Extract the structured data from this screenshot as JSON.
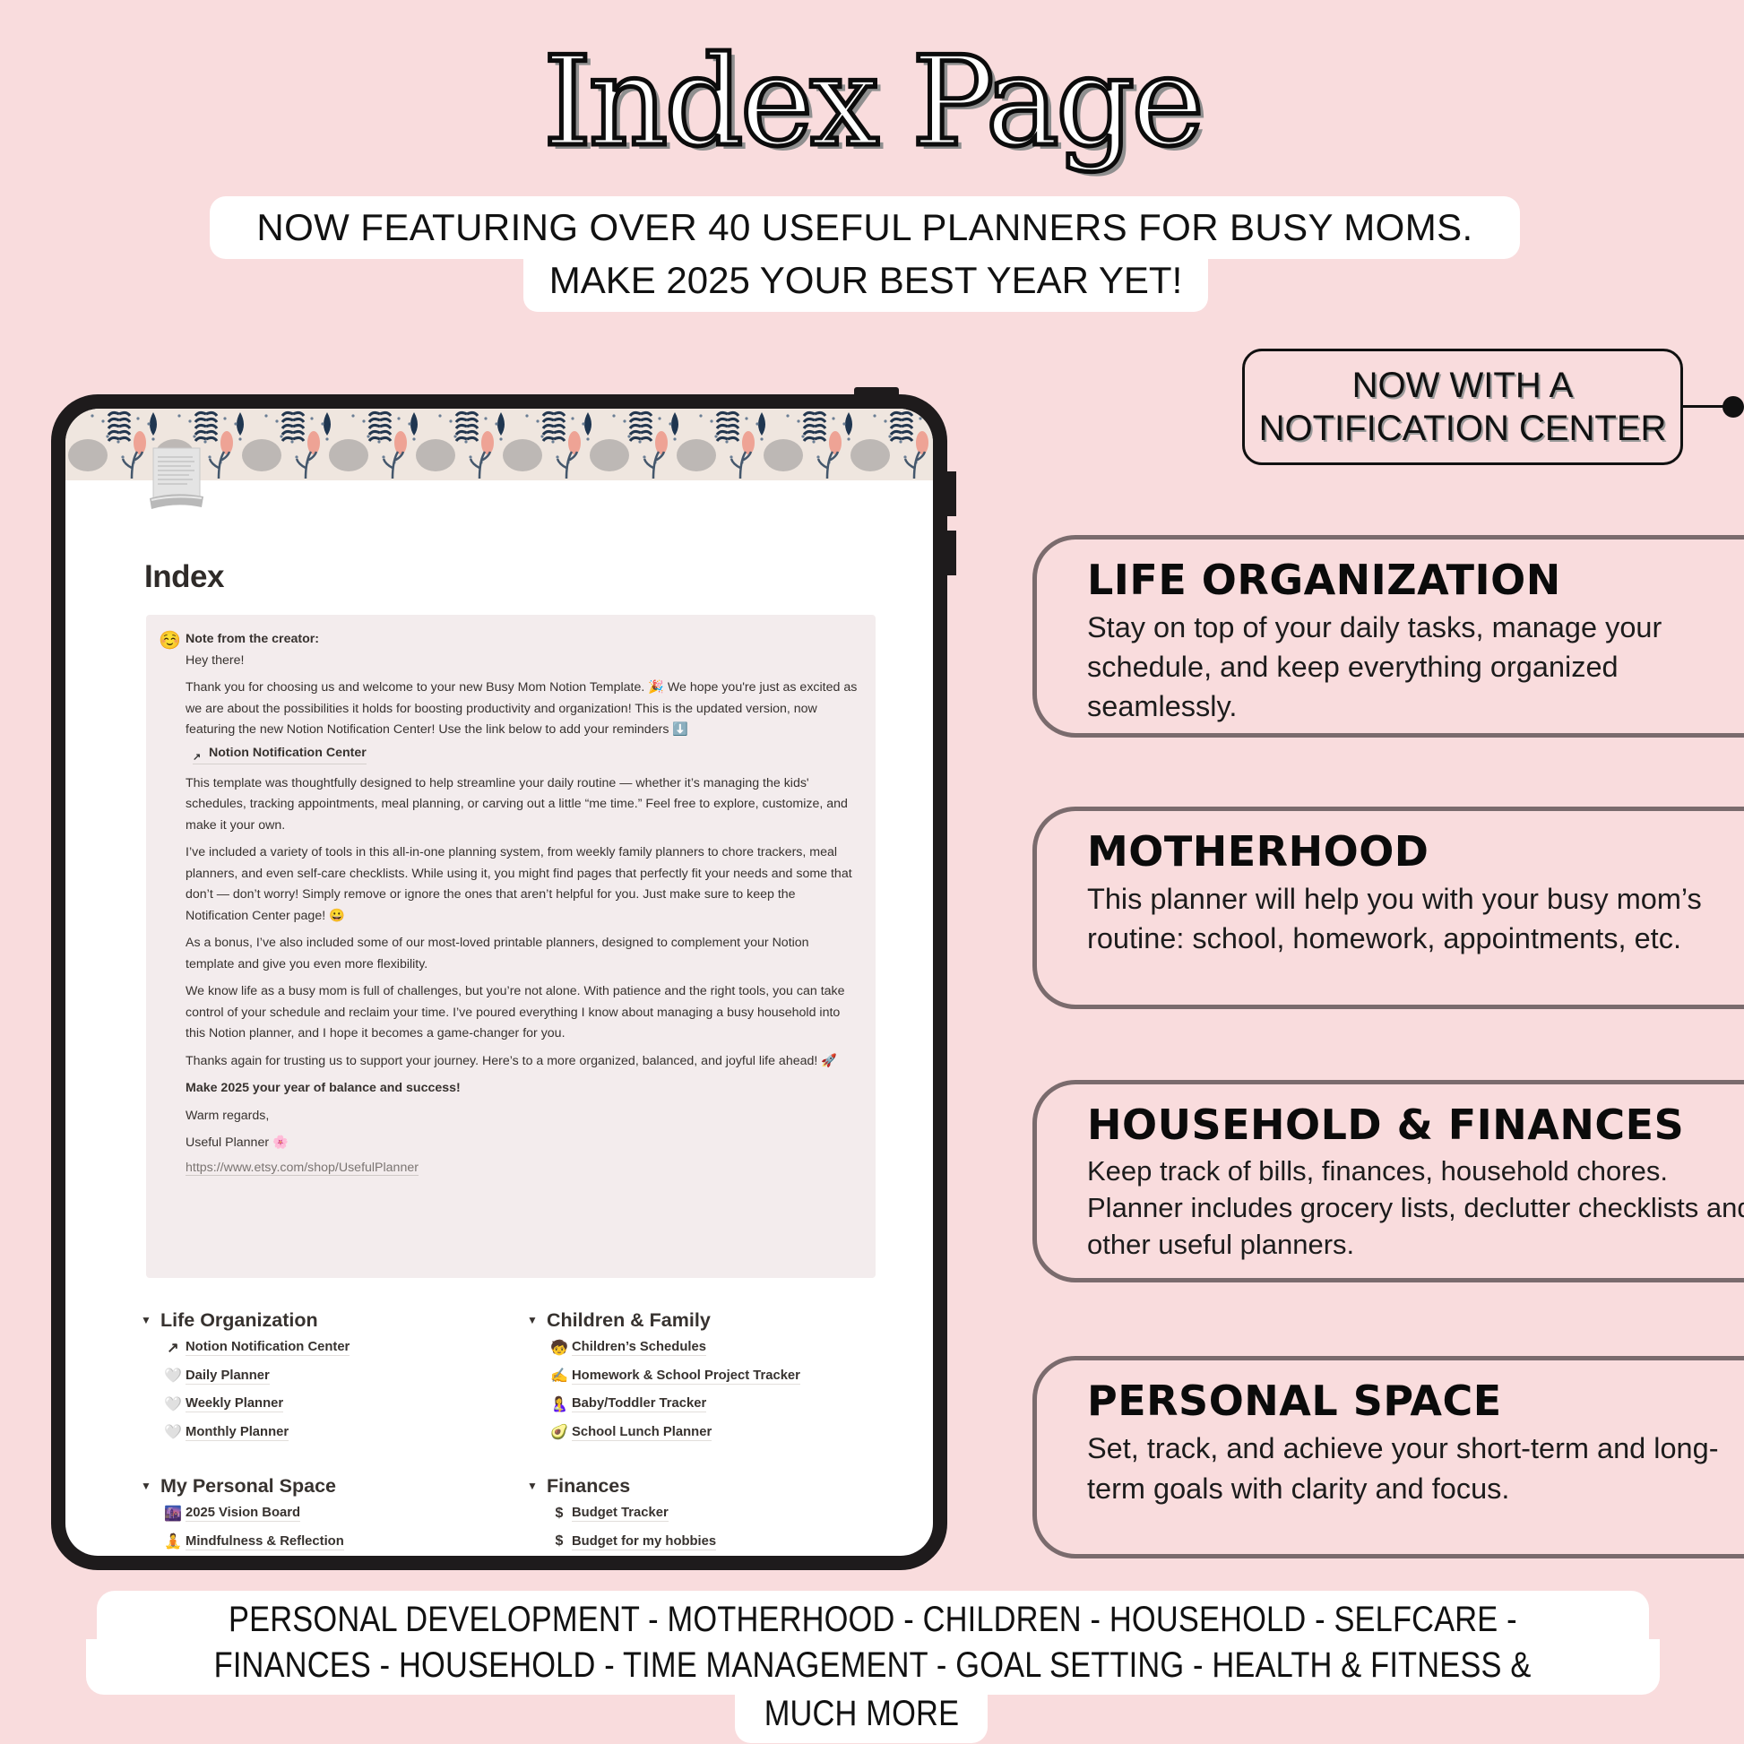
{
  "header": {
    "title": "Index Page",
    "subtitle_line1": "NOW FEATURING OVER 40 USEFUL PLANNERS FOR BUSY MOMS.",
    "subtitle_line2": "MAKE 2025 YOUR BEST YEAR YET!"
  },
  "notification_badge": {
    "line1": "NOW WITH A",
    "line2": "NOTIFICATION CENTER"
  },
  "features": [
    {
      "title": "LIFE ORGANIZATION",
      "description": "Stay on top of your daily tasks, manage your schedule, and keep everything organized seamlessly."
    },
    {
      "title": "MOTHERHOOD",
      "description": "This planner will help you with your busy mom’s routine: school, homework, appointments, etc."
    },
    {
      "title": "HOUSEHOLD & FINANCES",
      "description": "Keep track of bills, finances, household chores. Planner includes grocery lists, declutter checklists and other useful planners."
    },
    {
      "title": "PERSONAL SPACE",
      "description": "Set, track, and achieve your short-term and long-term goals with clarity and focus."
    }
  ],
  "notion_page": {
    "title": "Index",
    "page_icon": "scroll-icon",
    "callout": {
      "emoji": "☺️",
      "heading": "Note from the creator:",
      "greeting": "Hey there!",
      "para1": "Thank you for choosing us and welcome to your new Busy Mom Notion Template. 🎉 We hope you're just as excited as we are about the possibilities it holds for boosting productivity and organization! This is the updated version, now featuring the new Notion Notification Center! Use the link below to add your reminders ⬇️",
      "link_label": "Notion Notification Center",
      "para2": "This template was thoughtfully designed to help streamline your daily routine — whether it’s managing the kids' schedules, tracking appointments, meal planning, or carving out a little “me time.” Feel free to explore, customize, and make it your own.",
      "para3": "I’ve included a variety of tools in this all-in-one planning system, from weekly family planners to chore trackers, meal planners, and even self-care checklists. While using it, you might find pages that perfectly fit your needs and some that don’t — don’t worry! Simply remove or ignore the ones that aren’t helpful for you. Just make sure to keep the Notification Center page! 😀",
      "para4": "As a bonus, I’ve also included some of our most-loved printable planners, designed to complement your Notion template and give you even more flexibility.",
      "para5": "We know life as a busy mom is full of challenges, but you’re not alone. With patience and the right tools, you can take control of your schedule and reclaim your time. I’ve poured everything I know about managing a busy household into this Notion planner, and I hope it becomes a game-changer for you.",
      "para6": "Thanks again for trusting us to support your journey. Here’s to a more organized, balanced, and joyful life ahead! 🚀",
      "closing_bold": "Make 2025 your year of balance and success!",
      "signoff": "Warm regards,",
      "signature": "Useful Planner 🌸",
      "url": "https://www.etsy.com/shop/UsefulPlanner"
    },
    "sections": [
      {
        "title": "Life Organization",
        "items": [
          {
            "icon": "⸝",
            "icon_name": "link-page-icon",
            "label": "Notion Notification Center"
          },
          {
            "icon": "🤍",
            "icon_name": "white-heart-icon",
            "label": "Daily Planner"
          },
          {
            "icon": "🤍",
            "icon_name": "white-heart-icon",
            "label": "Weekly Planner"
          },
          {
            "icon": "🤍",
            "icon_name": "white-heart-icon",
            "label": "Monthly Planner"
          }
        ]
      },
      {
        "title": "Children & Family",
        "items": [
          {
            "icon": "🧒",
            "icon_name": "child-icon",
            "label": "Children’s Schedules"
          },
          {
            "icon": "✍️",
            "icon_name": "writing-hand-icon",
            "label": "Homework & School Project Tracker"
          },
          {
            "icon": "🤱",
            "icon_name": "mother-baby-icon",
            "label": "Baby/Toddler Tracker"
          },
          {
            "icon": "🥑",
            "icon_name": "avocado-icon",
            "label": "School Lunch Planner"
          }
        ]
      },
      {
        "title": "My Personal Space",
        "items": [
          {
            "icon": "🌆",
            "icon_name": "city-sunset-icon",
            "label": "2025 Vision Board"
          },
          {
            "icon": "🧘",
            "icon_name": "meditation-icon",
            "label": "Mindfulness & Reflection"
          }
        ]
      },
      {
        "title": "Finances",
        "items": [
          {
            "icon": "$",
            "icon_name": "dollar-icon",
            "label": "Budget Tracker"
          },
          {
            "icon": "$",
            "icon_name": "dollar-icon",
            "label": "Budget for my hobbies"
          }
        ]
      }
    ]
  },
  "footer": {
    "line1": "PERSONAL DEVELOPMENT -  MOTHERHOOD - CHILDREN - HOUSEHOLD - SELFCARE -",
    "line2": "FINANCES - HOUSEHOLD - TIME MANAGEMENT - GOAL SETTING - HEALTH & FITNESS &",
    "line3": "MUCH MORE"
  },
  "colors": {
    "background": "#f9dcdd",
    "tablet_frame": "#1e1b1c",
    "card_border": "#7a6b6d",
    "callout_bg": "#f3eced"
  }
}
